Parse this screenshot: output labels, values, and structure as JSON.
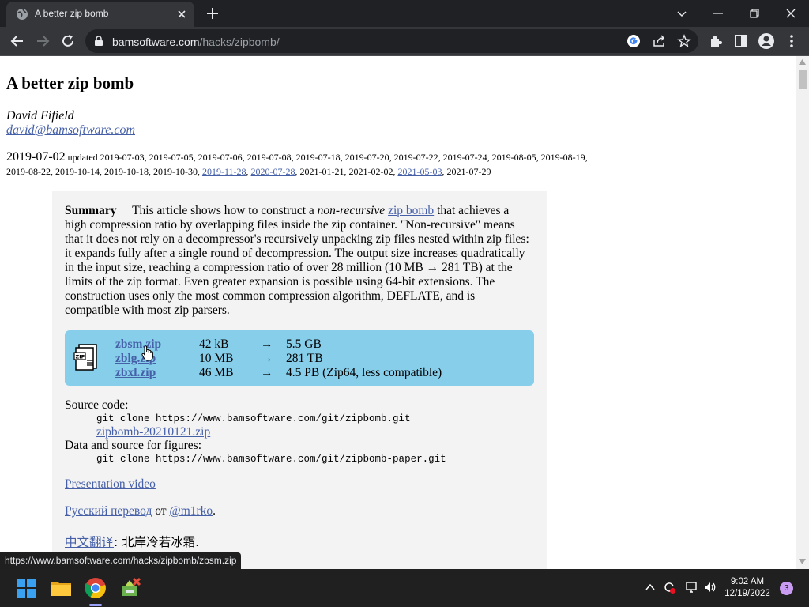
{
  "browser": {
    "tab_title": "A better zip bomb",
    "url_host": "bamsoftware.com",
    "url_path": "/hacks/zipbomb/"
  },
  "page": {
    "title": "A better zip bomb",
    "author": "David Fifield",
    "email": "david@bamsoftware.com",
    "date_main": "2019-07-02",
    "updated_label": "updated",
    "dates_plain_1": "2019-07-03, 2019-07-05, 2019-07-06, 2019-07-08, 2019-07-18, 2019-07-20, 2019-07-22, 2019-07-24, 2019-08-05, 2019-08-19, 2019-08-22, 2019-10-14, 2019-10-18, 2019-10-30,",
    "date_link_1": "2019-11-28",
    "sep_1": ",",
    "date_link_2": "2020-07-28",
    "dates_plain_2": ", 2021-01-21, 2021-02-02,",
    "date_link_3": "2021-05-03",
    "dates_plain_3": ", 2021-07-29",
    "summary_label": "Summary",
    "summary_part1": "This article shows how to construct a",
    "summary_em": "non-recursive",
    "summary_link": "zip bomb",
    "summary_part2": "that achieves a high compression ratio by overlapping files inside the zip container. \"Non-recursive\" means that it does not rely on a decompressor's recursively unpacking zip files nested within zip files: it expands fully after a single round of decompression. The output size increases quadratically in the input size, reaching a compression ratio of over 28 million (10 MB → 281 TB) at the limits of the zip format. Even greater expansion is possible using 64-bit extensions. The construction uses only the most common compression algorithm, DEFLATE, and is compatible with most zip parsers.",
    "downloads": [
      {
        "name": "zbsm.zip",
        "size": "42 kB",
        "arrow": "→",
        "result": "5.5 GB"
      },
      {
        "name": "zblg.zip",
        "size": "10 MB",
        "arrow": "→",
        "result": "281 TB"
      },
      {
        "name": "zbxl.zip",
        "size": "46 MB",
        "arrow": "→",
        "result": "4.5 PB (Zip64, less compatible)"
      }
    ],
    "source_label": "Source code:",
    "source_cmd": "git clone https://www.bamsoftware.com/git/zipbomb.git",
    "source_zip": "zipbomb-20210121.zip",
    "data_label": "Data and source for figures:",
    "data_cmd": "git clone https://www.bamsoftware.com/git/zipbomb-paper.git",
    "video_link": "Presentation video",
    "russian_link": "Русский перевод",
    "russian_by": "от",
    "russian_author": "@m1rko",
    "russian_end": ".",
    "chinese_link": "中文翻译",
    "chinese_rest": ": 北岸冷若冰霜."
  },
  "status_url": "https://www.bamsoftware.com/hacks/zipbomb/zbsm.zip",
  "taskbar": {
    "time": "9:02 AM",
    "date": "12/19/2022",
    "notifications": "3"
  },
  "colors": {
    "link": "#4660a8",
    "download_box": "#87ceeb",
    "panel": "#f3f3f3",
    "chrome_dark": "#202124",
    "chrome_toolbar": "#35363a"
  }
}
